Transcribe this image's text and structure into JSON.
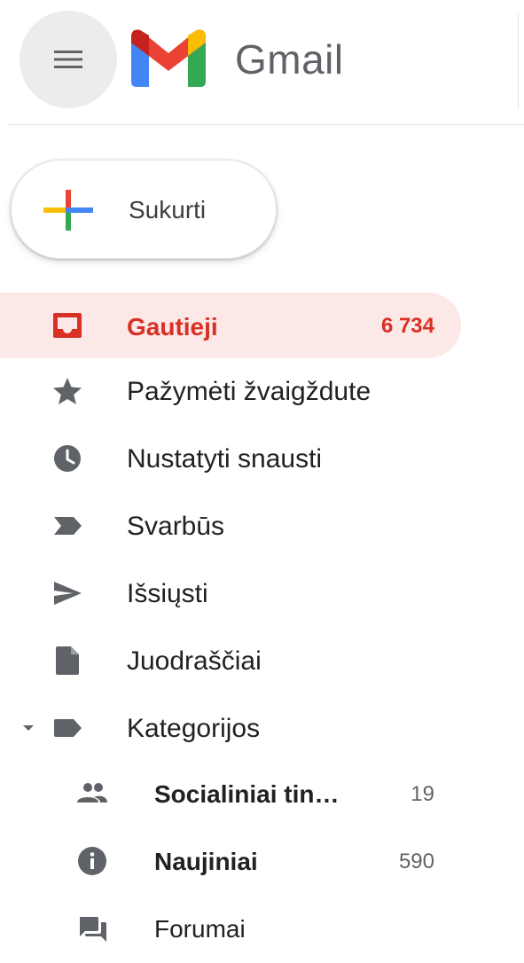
{
  "header": {
    "app_name": "Gmail",
    "menu_icon": "hamburger-menu-icon",
    "logo_icon": "gmail-m-logo-icon"
  },
  "compose": {
    "label": "Sukurti",
    "icon": "colored-plus-icon"
  },
  "nav": {
    "items": [
      {
        "label": "Gautieji",
        "count": "6 734",
        "icon": "inbox-icon",
        "active": true
      },
      {
        "label": "Pažymėti žvaigždute",
        "count": "",
        "icon": "star-icon"
      },
      {
        "label": "Nustatyti snausti",
        "count": "",
        "icon": "clock-icon"
      },
      {
        "label": "Svarbūs",
        "count": "",
        "icon": "important-label-icon"
      },
      {
        "label": "Išsiųsti",
        "count": "",
        "icon": "send-icon"
      },
      {
        "label": "Juodraščiai",
        "count": "",
        "icon": "draft-document-icon"
      },
      {
        "label": "Kategorijos",
        "count": "",
        "icon": "label-icon"
      }
    ],
    "categories": [
      {
        "label": "Socialiniai tin…",
        "count": "19",
        "icon": "people-icon",
        "bold": true
      },
      {
        "label": "Naujiniai",
        "count": "590",
        "icon": "info-icon",
        "bold": true
      },
      {
        "label": "Forumai",
        "count": "",
        "icon": "forum-icon",
        "bold": false
      }
    ]
  },
  "colors": {
    "active_bg": "#fce8e6",
    "active_text": "#d93025",
    "icon_gray": "#5f6368"
  }
}
